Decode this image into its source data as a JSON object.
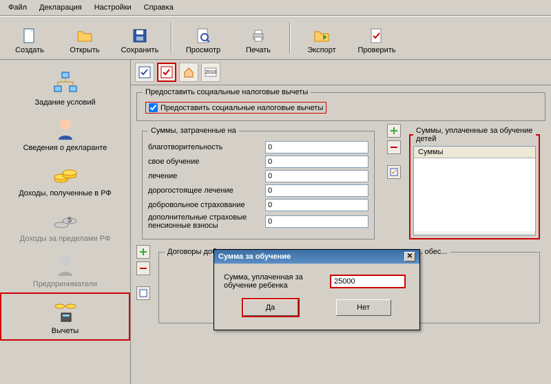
{
  "menubar": [
    "Файл",
    "Декларация",
    "Настройки",
    "Справка"
  ],
  "toolbar": {
    "create": "Создать",
    "open": "Открыть",
    "save": "Сохранить",
    "preview": "Просмотр",
    "print": "Печать",
    "export": "Экспорт",
    "check": "Проверить"
  },
  "sidebar": {
    "items": [
      {
        "label": "Задание условий"
      },
      {
        "label": "Сведения о декларанте"
      },
      {
        "label": "Доходы, полученные в РФ"
      },
      {
        "label": "Доходы за пределами РФ",
        "disabled": true
      },
      {
        "label": "Предприниматели",
        "disabled": true
      },
      {
        "label": "Вычеты",
        "selected": true
      }
    ]
  },
  "work_toolbar_year": "2010",
  "social_group": {
    "legend": "Предоставить социальные налоговые вычеты",
    "checkbox_label": "Предоставить социальные налоговые вычеты",
    "checked": true
  },
  "spent": {
    "legend": "Суммы, затраченные на",
    "rows": [
      {
        "label": "благотворительность",
        "value": "0"
      },
      {
        "label": "свое обучение",
        "value": "0"
      },
      {
        "label": "лечение",
        "value": "0"
      },
      {
        "label": "дорогостоящее лечение",
        "value": "0"
      },
      {
        "label": "добровольное страхование",
        "value": "0"
      },
      {
        "label": "дополнительные страховые пенсионные взносы",
        "value": "0"
      }
    ]
  },
  "paid_children": {
    "legend": "Суммы, уплаченные за обучение детей",
    "header": "Суммы"
  },
  "contracts": {
    "legend": "Договоры добровольного пенс. страхования и негосударственного пенс. обес..."
  },
  "dialog": {
    "title": "Сумма за обучение",
    "label": "Сумма, уплаченная за обучение ребенка",
    "value": "25000",
    "ok": "Да",
    "cancel": "Нет"
  }
}
